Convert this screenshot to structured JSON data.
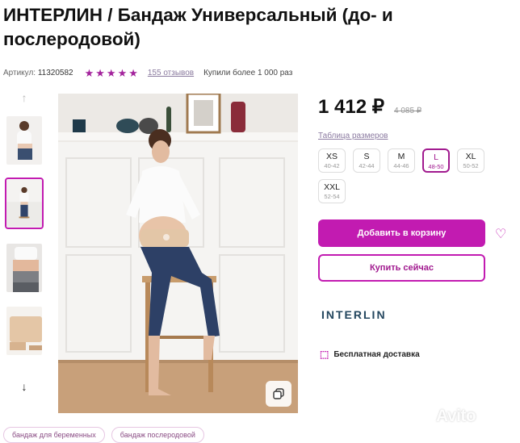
{
  "product": {
    "title": "ИНТЕРЛИН / Бандаж Универсальный (до- и послеродовой)",
    "article_label": "Артикул:",
    "article_value": "11320582",
    "rating": 5,
    "reviews": "155 отзывов",
    "bought": "Купили более 1 000 раз"
  },
  "price": {
    "current": "1 412 ₽",
    "old": "4 085 ₽"
  },
  "size_table_label": "Таблица размеров",
  "sizes": [
    {
      "size": "XS",
      "range": "40-42",
      "selected": false
    },
    {
      "size": "S",
      "range": "42-44",
      "selected": false
    },
    {
      "size": "M",
      "range": "44-46",
      "selected": false
    },
    {
      "size": "L",
      "range": "48-50",
      "selected": true
    },
    {
      "size": "XL",
      "range": "50-52",
      "selected": false
    },
    {
      "size": "XXL",
      "range": "52-54",
      "selected": false
    }
  ],
  "buttons": {
    "add_to_cart": "Добавить в корзину",
    "buy_now": "Купить сейчас"
  },
  "brand": "INTERLIN",
  "delivery": "Бесплатная доставка",
  "tags": [
    "бандаж для беременных",
    "бандаж послеродовой"
  ],
  "watermark": "Avito",
  "icons": {
    "up": "chevron-up-icon",
    "down": "chevron-down-icon",
    "star": "star-icon",
    "heart": "heart-icon",
    "copy": "copy-icon",
    "delivery": "box-icon"
  },
  "colors": {
    "accent": "#c21bb1",
    "star": "#a3239c"
  }
}
